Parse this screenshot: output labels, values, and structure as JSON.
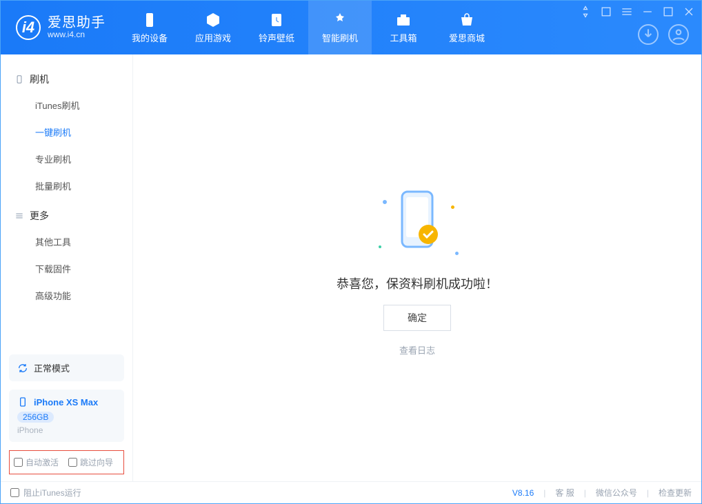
{
  "app": {
    "name_cn": "爱思助手",
    "name_en": "www.i4.cn"
  },
  "tabs": {
    "device": "我的设备",
    "apps": "应用游戏",
    "ringtones": "铃声壁纸",
    "flash": "智能刷机",
    "toolbox": "工具箱",
    "store": "爱思商城"
  },
  "sidebar": {
    "group1_title": "刷机",
    "items1": {
      "itunes": "iTunes刷机",
      "onekey": "一键刷机",
      "pro": "专业刷机",
      "batch": "批量刷机"
    },
    "group2_title": "更多",
    "items2": {
      "other": "其他工具",
      "firmware": "下载固件",
      "advanced": "高级功能"
    },
    "mode": "正常模式",
    "device_name": "iPhone XS Max",
    "device_storage": "256GB",
    "device_sub": "iPhone",
    "opt_auto": "自动激活",
    "opt_skip": "跳过向导"
  },
  "main": {
    "success_msg": "恭喜您，保资料刷机成功啦！",
    "ok_btn": "确定",
    "log_link": "查看日志"
  },
  "footer": {
    "block_itunes": "阻止iTunes运行",
    "version": "V8.16",
    "service": "客 服",
    "wechat": "微信公众号",
    "update": "检查更新"
  }
}
